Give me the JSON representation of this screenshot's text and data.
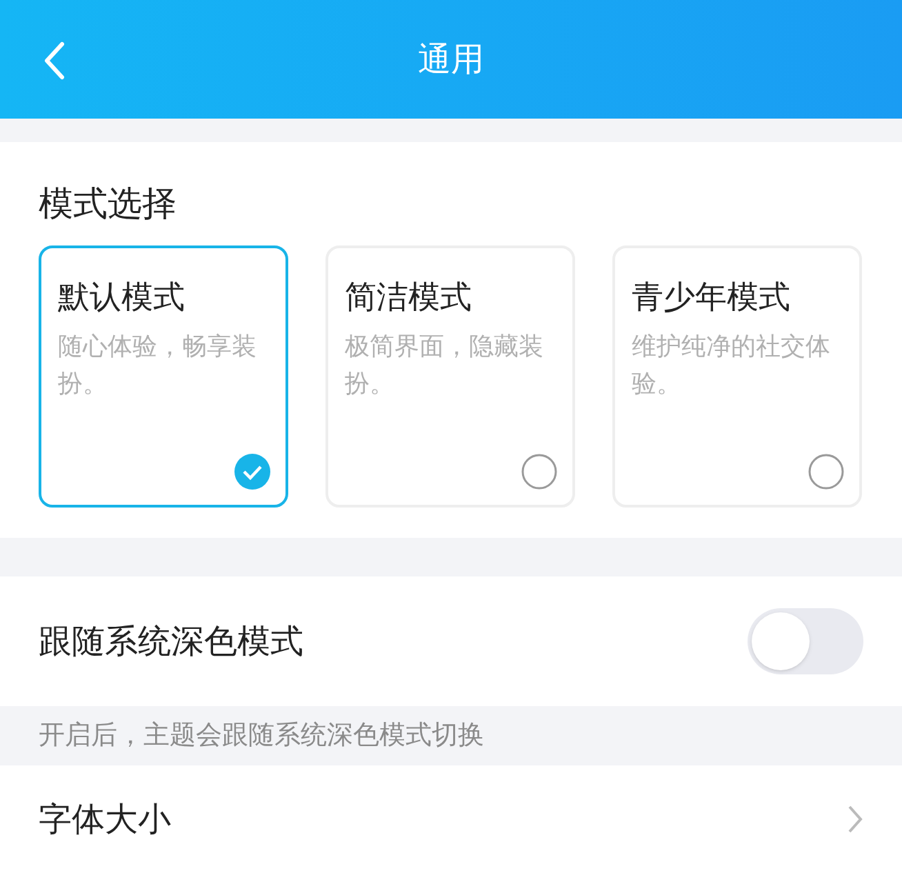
{
  "header": {
    "title": "通用"
  },
  "mode_section": {
    "title": "模式选择",
    "modes": [
      {
        "name": "默认模式",
        "description": "随心体验，畅享装扮。",
        "selected": true
      },
      {
        "name": "简洁模式",
        "description": "极简界面，隐藏装扮。",
        "selected": false
      },
      {
        "name": "青少年模式",
        "description": "维护纯净的社交体验。",
        "selected": false
      }
    ]
  },
  "dark_mode": {
    "label": "跟随系统深色模式",
    "on": false,
    "hint": "开启后，主题会跟随系统深色模式切换"
  },
  "font_size": {
    "label": "字体大小"
  }
}
